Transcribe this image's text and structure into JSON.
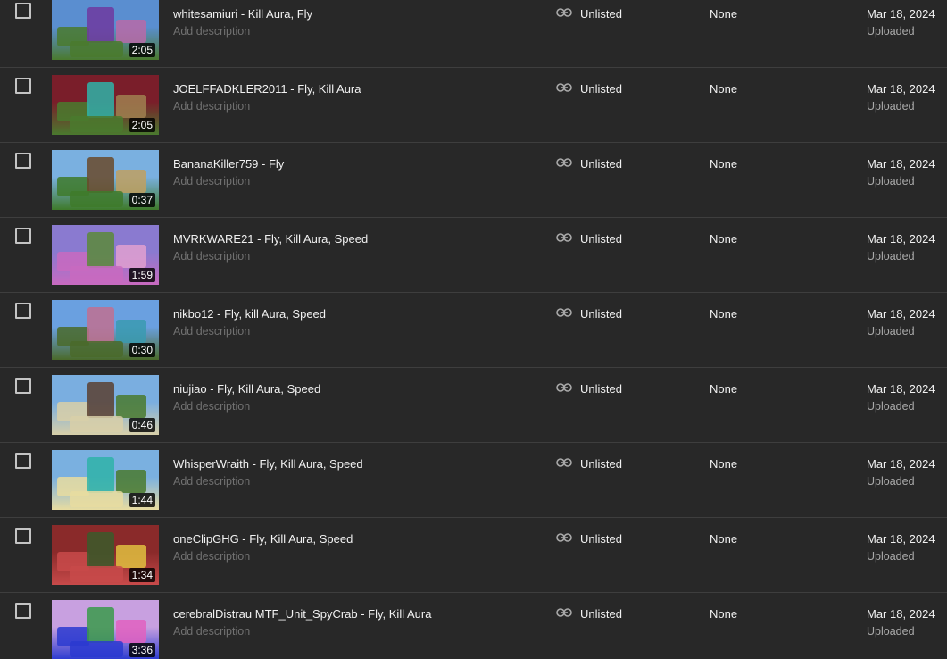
{
  "videos": [
    {
      "title": "whitesamiuri - Kill Aura, Fly",
      "description_placeholder": "Add description",
      "duration": "2:05",
      "visibility": "Unlisted",
      "restrictions": "None",
      "date": "Mar 18, 2024",
      "date_status": "Uploaded",
      "thumb_colors": [
        "#5a8ed0",
        "#4a7a2e",
        "#6e3aa0",
        "#b86aa8"
      ]
    },
    {
      "title": "JOELFFADKLER2011 - Fly, Kill Aura",
      "description_placeholder": "Add description",
      "duration": "2:05",
      "visibility": "Unlisted",
      "restrictions": "None",
      "date": "Mar 18, 2024",
      "date_status": "Uploaded",
      "thumb_colors": [
        "#7a1e2a",
        "#4a7a2e",
        "#2fb3a8",
        "#a08050"
      ]
    },
    {
      "title": "BananaKiller759 - Fly",
      "description_placeholder": "Add description",
      "duration": "0:37",
      "visibility": "Unlisted",
      "restrictions": "None",
      "date": "Mar 18, 2024",
      "date_status": "Uploaded",
      "thumb_colors": [
        "#7ab0e0",
        "#3e7a2a",
        "#6a4a2a",
        "#c0a060"
      ]
    },
    {
      "title": "MVRKWARE21 - Fly, Kill Aura, Speed",
      "description_placeholder": "Add description",
      "duration": "1:59",
      "visibility": "Unlisted",
      "restrictions": "None",
      "date": "Mar 18, 2024",
      "date_status": "Uploaded",
      "thumb_colors": [
        "#8a7ad0",
        "#c86ac0",
        "#5a8a3a",
        "#e0a0d0"
      ]
    },
    {
      "title": "nikbo12 - Fly, kill Aura, Speed",
      "description_placeholder": "Add description",
      "duration": "0:30",
      "visibility": "Unlisted",
      "restrictions": "None",
      "date": "Mar 18, 2024",
      "date_status": "Uploaded",
      "thumb_colors": [
        "#6aa0e0",
        "#4a6a2a",
        "#c07090",
        "#3a9ab0"
      ]
    },
    {
      "title": "niujiao - Fly, Kill Aura, Speed",
      "description_placeholder": "Add description",
      "duration": "0:46",
      "visibility": "Unlisted",
      "restrictions": "None",
      "date": "Mar 18, 2024",
      "date_status": "Uploaded",
      "thumb_colors": [
        "#7aaee0",
        "#d8cfa8",
        "#5a4030",
        "#4a7a2e"
      ]
    },
    {
      "title": "WhisperWraith - Fly, Kill Aura, Speed",
      "description_placeholder": "Add description",
      "duration": "1:44",
      "visibility": "Unlisted",
      "restrictions": "None",
      "date": "Mar 18, 2024",
      "date_status": "Uploaded",
      "thumb_colors": [
        "#7ab0e0",
        "#e8dca0",
        "#2fb3a8",
        "#4a7a2e"
      ]
    },
    {
      "title": "oneClipGHG - Fly, Kill Aura, Speed",
      "description_placeholder": "Add description",
      "duration": "1:34",
      "visibility": "Unlisted",
      "restrictions": "None",
      "date": "Mar 18, 2024",
      "date_status": "Uploaded",
      "thumb_colors": [
        "#8a2a2a",
        "#c84a4a",
        "#3a5a2a",
        "#e0c040"
      ]
    },
    {
      "title": "cerebralDistrau MTF_Unit_SpyCrab - Fly, Kill Aura",
      "description_placeholder": "Add description",
      "duration": "3:36",
      "visibility": "Unlisted",
      "restrictions": "None",
      "date": "Mar 18, 2024",
      "date_status": "Uploaded",
      "thumb_colors": [
        "#c8a0e0",
        "#2a3ad0",
        "#3a9a4a",
        "#e060c0"
      ]
    }
  ],
  "icons": {
    "checkbox": "checkbox-unchecked",
    "visibility": "link-icon"
  },
  "colors": {
    "background": "#282828",
    "divider": "#3e3e3e",
    "text_primary": "#f1f1f1",
    "text_secondary": "#aaaaaa",
    "text_placeholder": "#717171"
  }
}
